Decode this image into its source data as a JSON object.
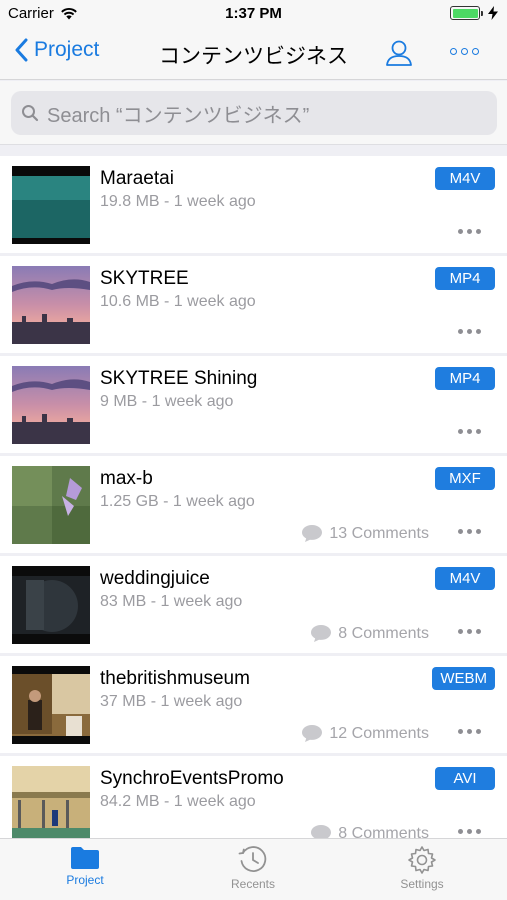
{
  "status_bar": {
    "carrier": "Carrier",
    "time": "1:37 PM",
    "battery_level": 1.0,
    "wifi_icon": "wifi-icon",
    "battery_icon": "battery-icon"
  },
  "nav": {
    "back_label": "Project",
    "title": "コンテンツビジネス",
    "user_icon": "user-icon",
    "more_icon": "more-icon",
    "accent_color": "#1a7be0"
  },
  "search": {
    "placeholder": "Search “コンテンツビジネス”"
  },
  "files": [
    {
      "title": "Maraetai",
      "meta": "19.8 MB - 1 week ago",
      "type": "M4V",
      "comments": ""
    },
    {
      "title": "SKYTREE",
      "meta": "10.6 MB - 1 week ago",
      "type": "MP4",
      "comments": ""
    },
    {
      "title": "SKYTREE Shining",
      "meta": "9 MB - 1 week ago",
      "type": "MP4",
      "comments": ""
    },
    {
      "title": "max-b",
      "meta": "1.25 GB - 1 week ago",
      "type": "MXF",
      "comments": "13 Comments"
    },
    {
      "title": "weddingjuice",
      "meta": "83 MB - 1 week ago",
      "type": "M4V",
      "comments": "8 Comments"
    },
    {
      "title": "thebritishmuseum",
      "meta": "37 MB - 1 week ago",
      "type": "WEBM",
      "comments": "12 Comments"
    },
    {
      "title": "SynchroEventsPromo",
      "meta": "84.2 MB - 1 week ago",
      "type": "AVI",
      "comments": "8 Comments"
    }
  ],
  "tabs": [
    {
      "label": "Project",
      "icon": "folder-icon",
      "active": true
    },
    {
      "label": "Recents",
      "icon": "clock-icon",
      "active": false
    },
    {
      "label": "Settings",
      "icon": "gear-icon",
      "active": false
    }
  ]
}
